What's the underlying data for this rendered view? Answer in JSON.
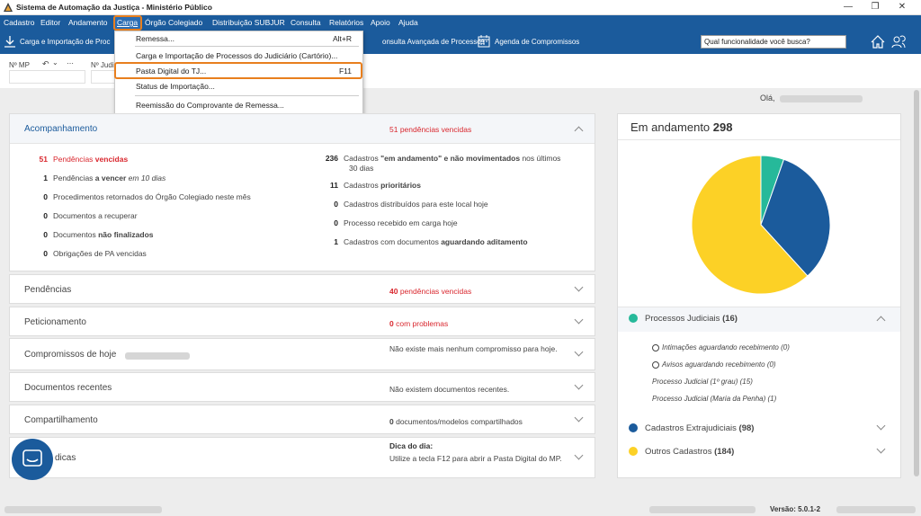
{
  "window": {
    "title": "Sistema de Automação da Justiça - Ministério Público"
  },
  "menubar": [
    "Cadastro",
    "Editor",
    "Andamento",
    "Carga",
    "Órgão Colegiado",
    "Distribuição SUBJUR",
    "Consulta",
    "Relatórios",
    "Apoio",
    "Ajuda"
  ],
  "toolbar": {
    "item1": "Carga e Importação de Proc",
    "item2": "onsulta Avançada de Processos",
    "item3": "Agenda de Compromissos",
    "search_placeholder": "Qual funcionalidade você busca?"
  },
  "filters": {
    "np_label": "Nº MP",
    "jud_label": "Nº Judi"
  },
  "carga_menu": [
    {
      "label": "Remessa...",
      "shortcut": "Alt+R"
    },
    {
      "label": "Carga e Importação de Processos do Judiciário (Cartório)...",
      "shortcut": ""
    },
    {
      "label": "Pasta Digital do TJ...",
      "shortcut": "F11"
    },
    {
      "label": "Status de Importação...",
      "shortcut": ""
    },
    {
      "label": "Reemissão do Comprovante de Remessa...",
      "shortcut": ""
    }
  ],
  "greeting": "Olá,",
  "acompanhamento": {
    "title": "Acompanhamento",
    "summary": "51 pendências vencidas",
    "left": [
      {
        "num": "51",
        "pre": "Pendências ",
        "bold": "vencidas",
        "post": "",
        "red": true
      },
      {
        "num": "1",
        "pre": "Pendências ",
        "bold": "a vencer",
        "post": " em 10 dias",
        "red": false
      },
      {
        "num": "0",
        "pre": "Procedimentos retornados do Órgão Colegiado neste mês",
        "bold": "",
        "post": "",
        "red": false
      },
      {
        "num": "0",
        "pre": "Documentos a recuperar",
        "bold": "",
        "post": "",
        "red": false
      },
      {
        "num": "0",
        "pre": "Documentos ",
        "bold": "não finalizados",
        "post": "",
        "red": false
      },
      {
        "num": "0",
        "pre": "Obrigações de PA vencidas",
        "bold": "",
        "post": "",
        "red": false
      }
    ],
    "right": [
      {
        "num": "236",
        "pre": "Cadastros ",
        "bold": "\"em andamento\" e não movimentados",
        "post": " nos últimos",
        "line2": "30 dias"
      },
      {
        "num": "11",
        "pre": "Cadastros ",
        "bold": "prioritários",
        "post": ""
      },
      {
        "num": "0",
        "pre": "Cadastros distribuídos para este local hoje",
        "bold": "",
        "post": ""
      },
      {
        "num": "0",
        "pre": "Processo recebido em carga hoje",
        "bold": "",
        "post": ""
      },
      {
        "num": "1",
        "pre": "Cadastros com documentos ",
        "bold": "aguardando aditamento",
        "post": ""
      }
    ]
  },
  "sections": [
    {
      "title": "Pendências",
      "num": "40",
      "text": " pendências vencidas",
      "red": true
    },
    {
      "title": "Peticionamento",
      "num": "0",
      "text": " com problemas",
      "red": true
    },
    {
      "title": "Compromissos de hoje",
      "num": "",
      "text": "Não existe mais nenhum compromisso para hoje.",
      "red": false
    },
    {
      "title": "Documentos recentes",
      "num": "",
      "text": "Não existem documentos recentes.",
      "red": false
    },
    {
      "title": "Compartilhamento",
      "num": "0",
      "text": " documentos/modelos compartilhados",
      "red": false
    },
    {
      "title": "dicas",
      "num": "",
      "text": "Utilize a tecla F12 para abrir a Pasta Digital do MP.",
      "heading": "Dica do dia:",
      "red": false
    }
  ],
  "andamento": {
    "label": "Em andamento",
    "total": "298"
  },
  "chart_data": {
    "type": "pie",
    "categories": [
      "Processos Judiciais",
      "Cadastros Extrajudiciais",
      "Outros Cadastros"
    ],
    "values": [
      16,
      98,
      184
    ],
    "colors": [
      "#26b99a",
      "#1b5b9c",
      "#fcd126"
    ]
  },
  "legend": [
    {
      "name": "Processos Judiciais",
      "count": "(16)",
      "color": "#26b99a"
    },
    {
      "name": "Cadastros Extrajudiciais",
      "count": "(98)",
      "color": "#1b5b9c"
    },
    {
      "name": "Outros Cadastros",
      "count": "(184)",
      "color": "#fcd126"
    }
  ],
  "proc_sub": [
    "Intimações aguardando recebimento (0)",
    "Avisos aguardando recebimento (0)",
    "Processo Judicial (1º grau) (15)",
    "Processo Judicial (Maria da Penha) (1)"
  ],
  "status": {
    "version": "Versão: 5.0.1-2"
  }
}
